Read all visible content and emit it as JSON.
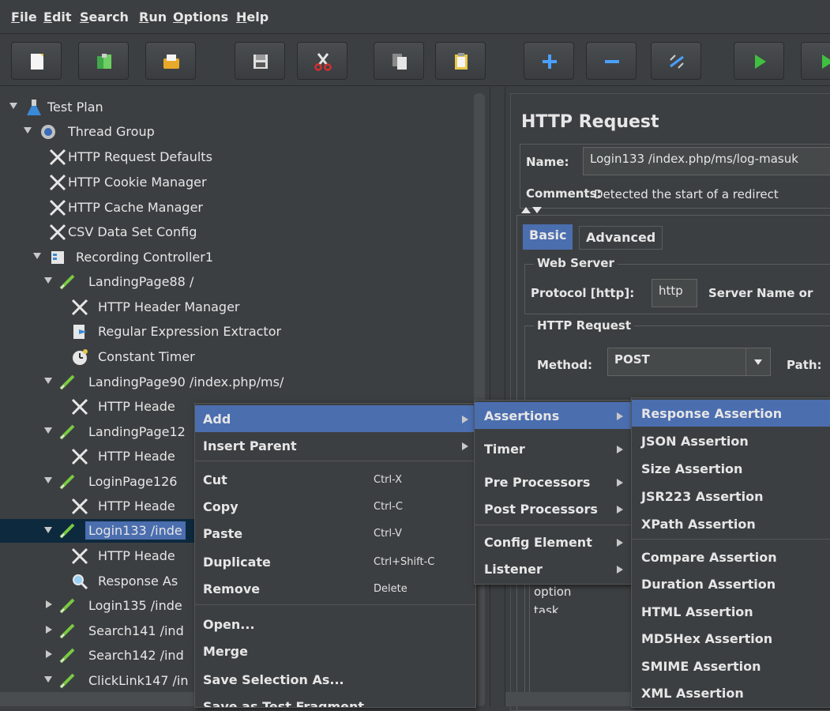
{
  "menubar": {
    "file": "File",
    "edit": "Edit",
    "search": "Search",
    "run": "Run",
    "options": "Options",
    "help": "Help"
  },
  "toolbar": {
    "buttons": [
      "new-icon",
      "templates-icon",
      "open-icon",
      "save-icon",
      "cut-icon",
      "copy-icon",
      "paste-icon",
      "expand-icon",
      "collapse-icon",
      "toggle-icon",
      "start-icon",
      "start-no-pause-icon"
    ]
  },
  "tree": {
    "test_plan": "Test Plan",
    "thread_group": "Thread Group",
    "http_request_defaults": "HTTP Request Defaults",
    "http_cookie_manager": "HTTP Cookie Manager",
    "http_cache_manager": "HTTP Cache Manager",
    "csv_data_set_config": "CSV Data Set Config",
    "recording_controller": "Recording Controller1",
    "landing88": "LandingPage88 /",
    "header_mgr_1": "HTTP Header Manager",
    "regex_extractor": "Regular Expression Extractor",
    "constant_timer": "Constant Timer",
    "landing90": "LandingPage90 /index.php/ms/",
    "header_mgr_2": "HTTP Heade",
    "landing12": "LandingPage12",
    "header_mgr_3": "HTTP Heade",
    "login126": "LoginPage126",
    "header_mgr_4": "HTTP Heade",
    "login133": "Login133 /inde",
    "header_mgr_5": "HTTP Heade",
    "response_assertion": "Response As",
    "login135": "Login135 /inde",
    "search141": "Search141 /ind",
    "search142": "Search142 /ind",
    "clicklink147": "ClickLink147 /in"
  },
  "panel": {
    "title": "HTTP Request",
    "name_label": "Name:",
    "name_value": "Login133 /index.php/ms/log-masuk",
    "comments_label": "Comments:",
    "comments_value": "Detected the start of a redirect",
    "tab_basic": "Basic",
    "tab_advanced": "Advanced",
    "web_server": "Web Server",
    "protocol_label": "Protocol [http]:",
    "protocol_value": "http",
    "server_name_label": "Server Name or",
    "http_request_group": "HTTP Request",
    "method_label": "Method:",
    "method_value": "POST",
    "path_label": "Path:",
    "param_option": "option",
    "param_task": "task"
  },
  "context_menu": {
    "add": "Add",
    "insert_parent": "Insert Parent",
    "cut": "Cut",
    "cut_sc": "Ctrl-X",
    "copy": "Copy",
    "copy_sc": "Ctrl-C",
    "paste": "Paste",
    "paste_sc": "Ctrl-V",
    "duplicate": "Duplicate",
    "duplicate_sc": "Ctrl+Shift-C",
    "remove": "Remove",
    "remove_sc": "Delete",
    "open": "Open...",
    "merge": "Merge",
    "save_selection": "Save Selection As...",
    "save_fragment": "Save as Test Fragment"
  },
  "add_submenu": {
    "assertions": "Assertions",
    "timer": "Timer",
    "pre_processors": "Pre Processors",
    "post_processors": "Post Processors",
    "config_element": "Config Element",
    "listener": "Listener"
  },
  "assertions_submenu": {
    "response": "Response Assertion",
    "json": "JSON Assertion",
    "size": "Size Assertion",
    "jsr223": "JSR223 Assertion",
    "xpath": "XPath Assertion",
    "compare": "Compare Assertion",
    "duration": "Duration Assertion",
    "html": "HTML Assertion",
    "md5hex": "MD5Hex Assertion",
    "smime": "SMIME Assertion",
    "xml": "XML Assertion"
  },
  "colors": {
    "background": "#3c3f41",
    "highlight": "#4b6eaf",
    "selection": "#0d293e"
  }
}
